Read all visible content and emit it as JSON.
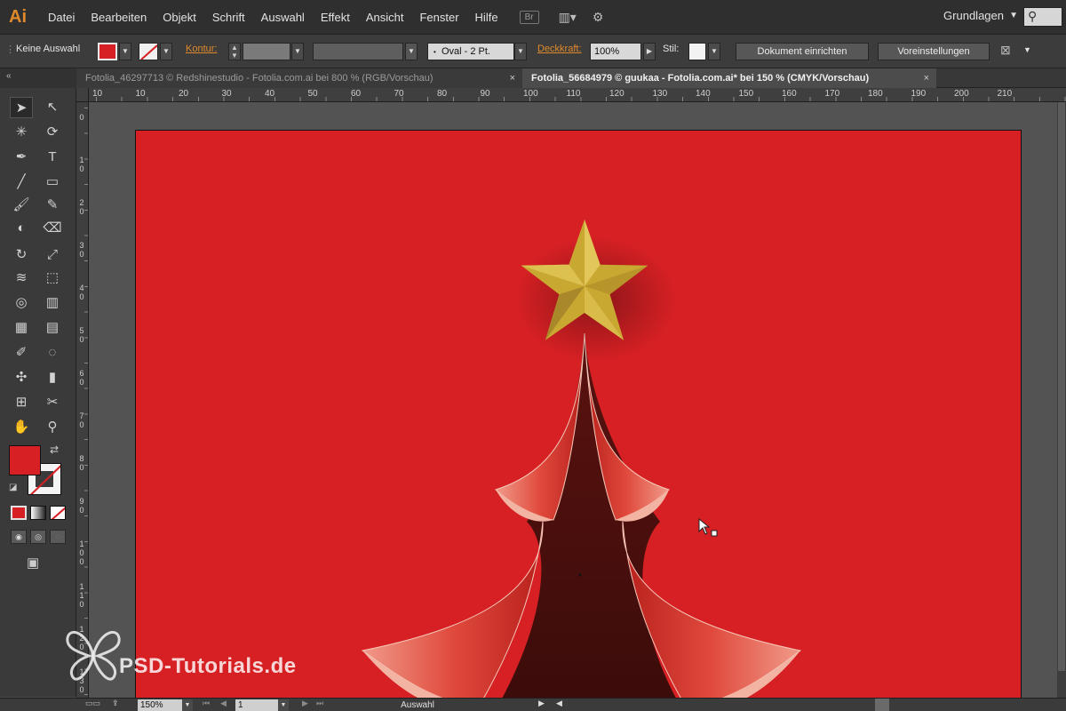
{
  "app": {
    "logo": "Ai"
  },
  "menu": [
    "Datei",
    "Bearbeiten",
    "Objekt",
    "Schrift",
    "Auswahl",
    "Effekt",
    "Ansicht",
    "Fenster",
    "Hilfe"
  ],
  "menubar_icons": {
    "bridge": "Br",
    "arrange": "arrange-documents-icon",
    "gpu": "gpu-performance-icon"
  },
  "workspace": {
    "label": "Grundlagen"
  },
  "search": {
    "icon": "search-icon"
  },
  "control": {
    "selection_label": "Keine Auswahl",
    "fill_color": "#d62024",
    "stroke_label": "Kontur:",
    "brush_value": "Oval - 2 Pt.",
    "opacity_label": "Deckkraft:",
    "opacity_value": "100%",
    "style_label": "Stil:",
    "doc_setup_button": "Dokument einrichten",
    "prefs_button": "Voreinstellungen"
  },
  "tabs": [
    {
      "label": "Fotolia_46297713 © Redshinestudio - Fotolia.com.ai bei 800 % (RGB/Vorschau)",
      "close": "×",
      "active": false
    },
    {
      "label": "Fotolia_56684979 © guukaa - Fotolia.com.ai* bei 150 % (CMYK/Vorschau)",
      "close": "×",
      "active": true
    }
  ],
  "ruler_h": [
    "10",
    "10",
    "20",
    "30",
    "40",
    "50",
    "60",
    "70",
    "80",
    "90",
    "100",
    "110",
    "120",
    "130",
    "140",
    "150",
    "160",
    "170",
    "180",
    "190",
    "200",
    "210"
  ],
  "ruler_v": [
    "0",
    "10",
    "20",
    "30",
    "40",
    "50",
    "60",
    "70",
    "80",
    "90",
    "100",
    "110",
    "120",
    "130"
  ],
  "colors": {
    "fill": "#d62024",
    "stroke": "none",
    "artboard": "#d62024",
    "star": "#c9a832",
    "accent": "#e08a2b"
  },
  "toolbar_glyphs": {
    "selection": "➤",
    "direct": "↖",
    "magic": "✳",
    "lasso": "⟳",
    "pen": "✒",
    "type": "T",
    "line": "╱",
    "rect": "▭",
    "brush": "🖌",
    "pencil": "✎",
    "blob": "◐",
    "eraser": "⌫",
    "rotate": "↻",
    "scale": "⤢",
    "warp": "≋",
    "free": "⬚",
    "shape_builder": "◎",
    "graph": "▥",
    "mesh": "▦",
    "gradient": "▤",
    "eyedropper": "✐",
    "blend": "◌",
    "symbol": "✣",
    "column": "▮",
    "artboard": "⊞",
    "slice": "✂",
    "hand": "✋",
    "zoom": "⚲",
    "swap": "⇄",
    "default": "◪",
    "screen_mode": "▣"
  },
  "status": {
    "zoom": "150%",
    "page": "1",
    "label": "Auswahl",
    "nav_first": "⏮",
    "nav_prev": "◀",
    "nav_next": "▶",
    "nav_last": "⏭",
    "play": "▶",
    "back": "◀"
  },
  "watermark": {
    "text": "PSD-Tutorials.de"
  }
}
